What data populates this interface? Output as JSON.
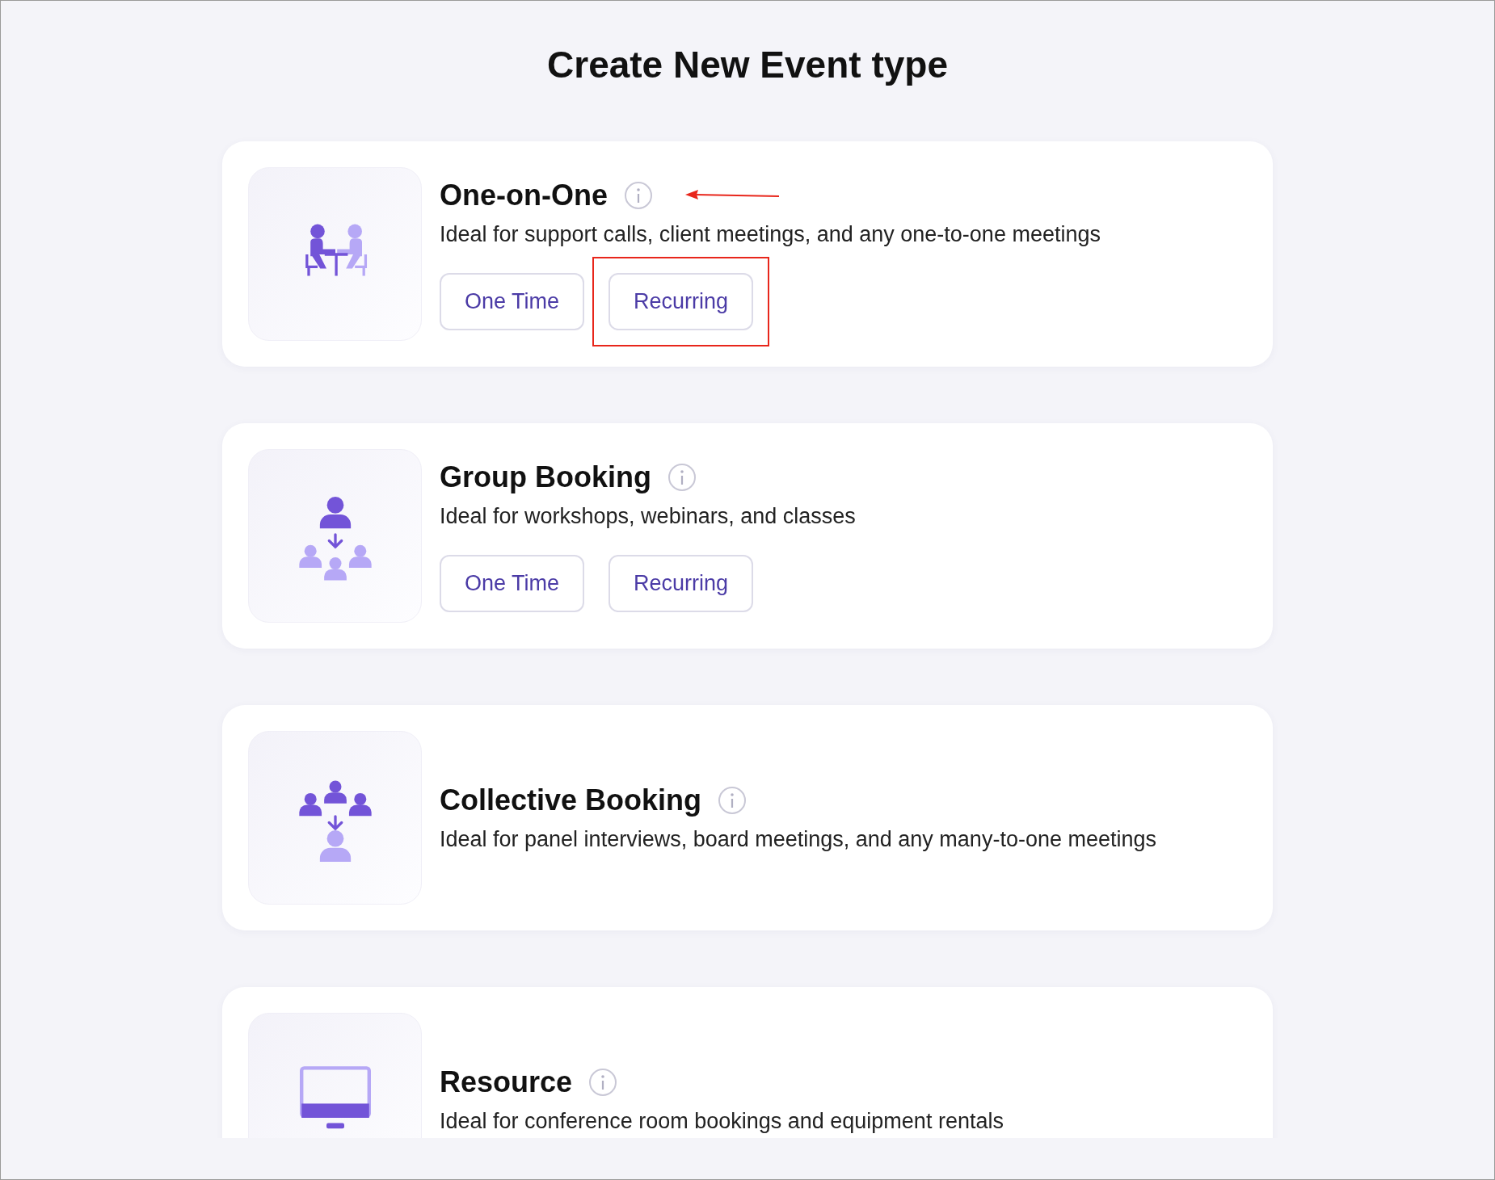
{
  "page_title": "Create New Event type",
  "event_types": [
    {
      "kind": "one_on_one",
      "title": "One-on-One",
      "description": "Ideal for support calls, client meetings, and any one-to-one meetings",
      "arrow_marker": true,
      "options": [
        {
          "label": "One Time",
          "highlighted": false
        },
        {
          "label": "Recurring",
          "highlighted": true
        }
      ]
    },
    {
      "kind": "group",
      "title": "Group Booking",
      "description": "Ideal for workshops, webinars, and classes",
      "arrow_marker": false,
      "options": [
        {
          "label": "One Time",
          "highlighted": false
        },
        {
          "label": "Recurring",
          "highlighted": false
        }
      ]
    },
    {
      "kind": "collective",
      "title": "Collective Booking",
      "description": "Ideal for panel interviews, board meetings, and any many-to-one meetings",
      "arrow_marker": false
    },
    {
      "kind": "resource",
      "title": "Resource",
      "description": "Ideal for conference room bookings and equipment rentals",
      "arrow_marker": false
    }
  ]
}
